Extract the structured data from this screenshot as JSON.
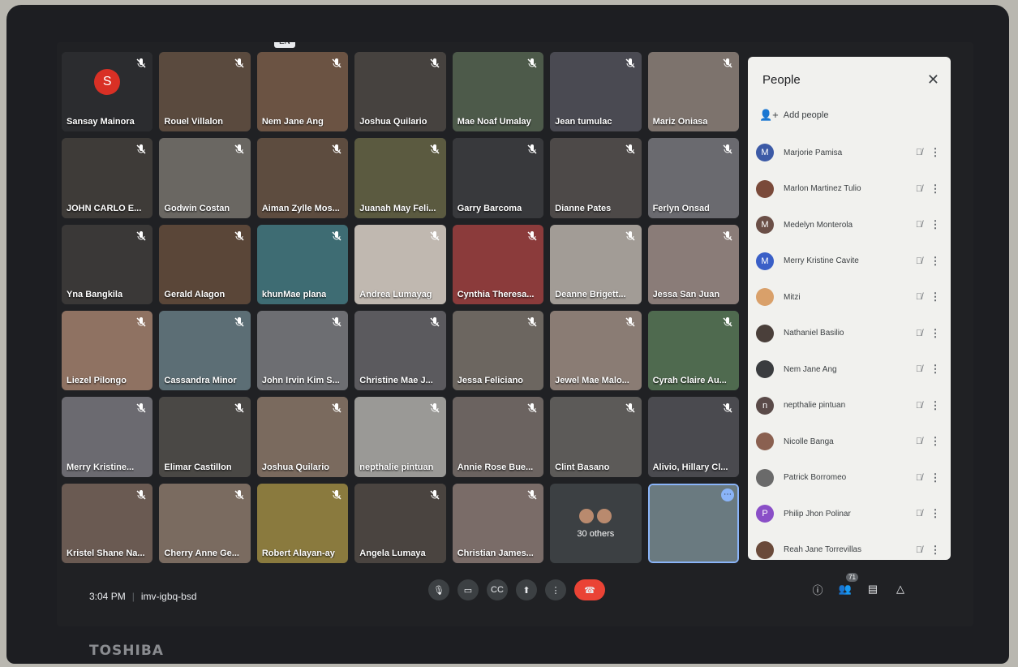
{
  "laptop_brand": "TOSHIBA",
  "language_selector": "EN",
  "tiles": [
    {
      "name": "Sansay Mainora",
      "avatar_letter": "S",
      "color": "#2b2c2f"
    },
    {
      "name": "Rouel Villalon",
      "color": "#5a4a3e"
    },
    {
      "name": "Nem Jane Ang",
      "color": "#6b5343"
    },
    {
      "name": "Joshua Quilario",
      "color": "#46423f"
    },
    {
      "name": "Mae Noaf Umalay",
      "color": "#4d5a4a"
    },
    {
      "name": "Jean tumulac",
      "color": "#4a4a52"
    },
    {
      "name": "Mariz Oniasa",
      "color": "#7d736d"
    },
    {
      "name": "JOHN CARLO E...",
      "color": "#3e3b38"
    },
    {
      "name": "Godwin Costan",
      "color": "#6a6762"
    },
    {
      "name": "Aiman Zylle Mos...",
      "color": "#5d4c3f"
    },
    {
      "name": "Juanah May Feli...",
      "color": "#5b5a40"
    },
    {
      "name": "Garry Barcoma",
      "color": "#38393c"
    },
    {
      "name": "Dianne Pates",
      "color": "#4d4948"
    },
    {
      "name": "Ferlyn Onsad",
      "color": "#6a6a6f"
    },
    {
      "name": "Yna Bangkila",
      "color": "#3a3837"
    },
    {
      "name": "Gerald Alagon",
      "color": "#5a4638"
    },
    {
      "name": "khunMae plana",
      "color": "#3e6c73"
    },
    {
      "name": "Andrea Lumayag",
      "color": "#c0b8b0"
    },
    {
      "name": "Cynthia Theresa...",
      "color": "#8b3b3b"
    },
    {
      "name": "Deanne Brigett...",
      "color": "#a29c96"
    },
    {
      "name": "Jessa San Juan",
      "color": "#8a7c78"
    },
    {
      "name": "Liezel Pilongo",
      "color": "#8f7262"
    },
    {
      "name": "Cassandra Minor",
      "color": "#5c6e75"
    },
    {
      "name": "John Irvin Kim S...",
      "color": "#6d6e72"
    },
    {
      "name": "Christine Mae J...",
      "color": "#5b5a5e"
    },
    {
      "name": "Jessa Feliciano",
      "color": "#6c6660"
    },
    {
      "name": "Jewel Mae Malo...",
      "color": "#8a7c74"
    },
    {
      "name": "Cyrah Claire Au...",
      "color": "#4f6a4f"
    },
    {
      "name": "Merry Kristine...",
      "color": "#6b6a70"
    },
    {
      "name": "Elimar Castillon",
      "color": "#4a4845"
    },
    {
      "name": "Joshua Quilario",
      "color": "#7a6a5e"
    },
    {
      "name": "nepthalie pintuan",
      "color": "#9a9996"
    },
    {
      "name": "Annie Rose Bue...",
      "color": "#6b6360"
    },
    {
      "name": "Clint Basano",
      "color": "#5c5a58"
    },
    {
      "name": "Alivio, Hillary Cl...",
      "color": "#4a4a4f"
    },
    {
      "name": "Kristel Shane Na...",
      "color": "#6a5a52"
    },
    {
      "name": "Cherry Anne Ge...",
      "color": "#7a6b60"
    },
    {
      "name": "Robert Alayan-ay",
      "color": "#8a7a3e"
    },
    {
      "name": "Angela Lumaya",
      "color": "#4a4440"
    },
    {
      "name": "Christian James...",
      "color": "#7a6c68"
    }
  ],
  "others_tile": {
    "label": "30 others"
  },
  "self_tile": {
    "color": "#6a7a80"
  },
  "people_panel": {
    "title": "People",
    "add_label": "Add people",
    "people": [
      {
        "name": "Marjorie Pamisa",
        "initial": "M",
        "color": "#3c5aa6"
      },
      {
        "name": "Marlon Martinez Tulio",
        "initial": "",
        "color": "#7a4a3a"
      },
      {
        "name": "Medelyn Monterola",
        "initial": "M",
        "color": "#6b4f47"
      },
      {
        "name": "Merry Kristine Cavite",
        "initial": "M",
        "color": "#3a5fc7"
      },
      {
        "name": "Mitzi",
        "initial": "",
        "color": "#d9a06a"
      },
      {
        "name": "Nathaniel Basilio",
        "initial": "",
        "color": "#4a3f3a"
      },
      {
        "name": "Nem Jane Ang",
        "initial": "",
        "color": "#3a3c3f"
      },
      {
        "name": "nepthalie pintuan",
        "initial": "n",
        "color": "#5a4a48"
      },
      {
        "name": "Nicolle Banga",
        "initial": "",
        "color": "#8a6050"
      },
      {
        "name": "Patrick Borromeo",
        "initial": "",
        "color": "#6a6a6a"
      },
      {
        "name": "Philip Jhon Polinar",
        "initial": "P",
        "color": "#8a4fc7"
      },
      {
        "name": "Reah Jane Torrevillas",
        "initial": "",
        "color": "#6a4a3a"
      }
    ]
  },
  "bottom_bar": {
    "time": "3:04 PM",
    "meeting_code": "imv-igbq-bsd",
    "participant_count": "71"
  }
}
